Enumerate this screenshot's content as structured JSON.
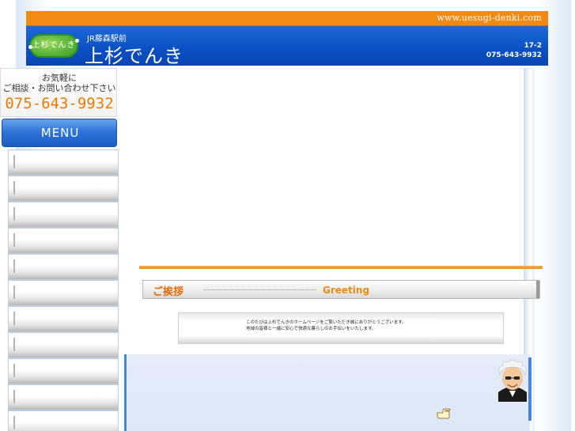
{
  "header": {
    "url": "www.uesugi-denki.com",
    "logo_text": "上杉でんき",
    "station": "JR藤森駅前",
    "shop_name": "上杉でんき",
    "address": "17-2",
    "phone": "075-643-9932"
  },
  "sidebar": {
    "contact_line1": "お気軽に",
    "contact_line2": "ご相談・お問い合わせ下さい",
    "contact_phone": "075-643-9932",
    "menu_title": "MENU",
    "menu_items": [
      "",
      "",
      "",
      "",
      "",
      "",
      "",
      "",
      "",
      "",
      ""
    ]
  },
  "main": {
    "greeting_ja": "ご挨拶",
    "greeting_en": "Greeting",
    "message_line1": "このたびは上杉でんきのホームページをご覧いただき誠にありがとうございます。",
    "message_line2": "地域の皆様と一緒に安心で快適な暮らしのお手伝いをいたします。"
  },
  "colors": {
    "accent_orange": "#f08a12",
    "header_blue": "#0b4fc4",
    "logo_green": "#5bb53a"
  }
}
